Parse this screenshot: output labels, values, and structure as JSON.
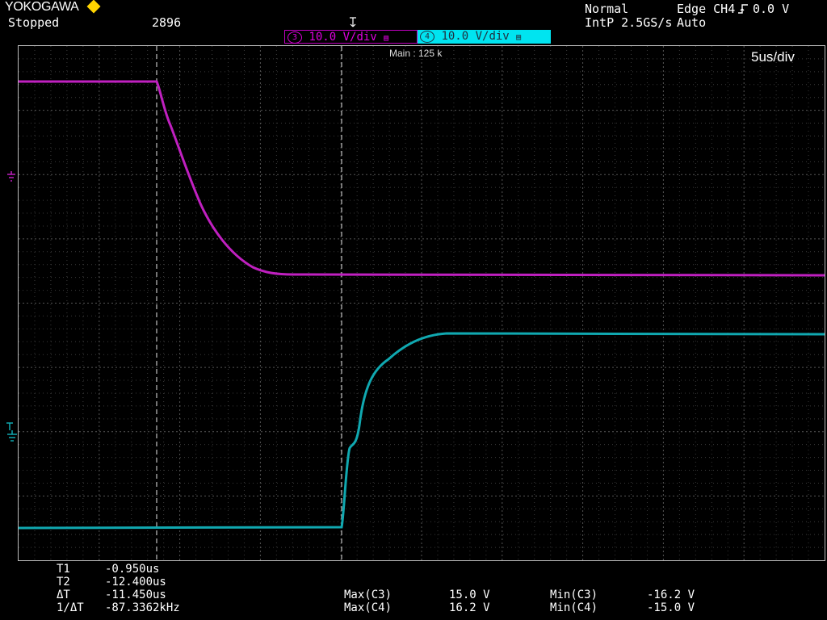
{
  "header": {
    "brand": "YOKOGAWA",
    "status": "Stopped",
    "acq_count": "2896",
    "mode": "Normal",
    "sample_rate": "IntP 2.5GS/s",
    "trigger": "Edge CH4",
    "trigger_level": "0.0 V",
    "trigger_mode": "Auto"
  },
  "channels": {
    "ch3": {
      "num": "3",
      "scale": "10.0 V/div",
      "color": "#c020c0"
    },
    "ch4": {
      "num": "4",
      "scale": "10.0 V/div",
      "color": "#10a8b0"
    }
  },
  "display": {
    "main_label": "Main : 125 k",
    "timebase": "5us/div",
    "grid_color": "#3a3a3a"
  },
  "cursors": {
    "t1_label": "T1",
    "t1_value": "-0.950us",
    "t2_label": "T2",
    "t2_value": "-12.400us",
    "dt_label": "ΔT",
    "dt_value": "-11.450us",
    "inv_dt_label": "1/ΔT",
    "inv_dt_value": "-87.3362kHz"
  },
  "measurements": [
    {
      "label": "Max(C3)",
      "value": "15.0 V",
      "label2": "Min(C3)",
      "value2": "-16.2 V"
    },
    {
      "label": "Max(C4)",
      "value": "16.2 V",
      "label2": "Min(C4)",
      "value2": "-15.0 V"
    }
  ]
}
